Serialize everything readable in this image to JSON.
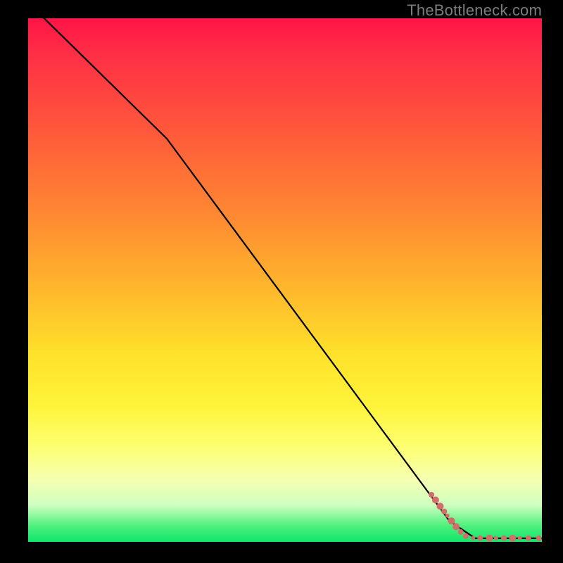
{
  "attribution": "TheBottleneck.com",
  "colors": {
    "gradient_top": "#ff1547",
    "gradient_mid": "#ffe12a",
    "gradient_bottom": "#10e66a",
    "curve": "#000000",
    "points": "#d26d6a",
    "background": "#000000"
  },
  "chart_data": {
    "type": "line",
    "title": "",
    "xlabel": "",
    "ylabel": "",
    "xlim": [
      0,
      100
    ],
    "ylim": [
      0,
      100
    ],
    "grid": false,
    "legend": false,
    "curve": [
      {
        "x": 0,
        "y": 103
      },
      {
        "x": 27,
        "y": 77
      },
      {
        "x": 82,
        "y": 4
      },
      {
        "x": 87,
        "y": 0.7
      },
      {
        "x": 100,
        "y": 0.7
      }
    ],
    "curve_note": "y is percent of plot height from bottom; two-segment descent with slight slope change near x≈27, then flat at bottom after x≈87",
    "points": [
      {
        "x": 78.5,
        "y": 9.0,
        "r": 4
      },
      {
        "x": 79.3,
        "y": 8.0,
        "r": 5
      },
      {
        "x": 80.2,
        "y": 6.8,
        "r": 5
      },
      {
        "x": 81.0,
        "y": 5.8,
        "r": 4
      },
      {
        "x": 81.6,
        "y": 5.0,
        "r": 3
      },
      {
        "x": 82.4,
        "y": 4.0,
        "r": 5
      },
      {
        "x": 83.3,
        "y": 2.9,
        "r": 5
      },
      {
        "x": 84.2,
        "y": 1.9,
        "r": 4
      },
      {
        "x": 85.2,
        "y": 1.1,
        "r": 4
      },
      {
        "x": 86.6,
        "y": 0.7,
        "r": 3
      },
      {
        "x": 88.0,
        "y": 0.7,
        "r": 4
      },
      {
        "x": 89.8,
        "y": 0.7,
        "r": 5
      },
      {
        "x": 91.1,
        "y": 0.7,
        "r": 3
      },
      {
        "x": 92.6,
        "y": 0.7,
        "r": 4
      },
      {
        "x": 94.3,
        "y": 0.7,
        "r": 5
      },
      {
        "x": 95.7,
        "y": 0.7,
        "r": 3
      },
      {
        "x": 97.4,
        "y": 0.7,
        "r": 4
      },
      {
        "x": 99.4,
        "y": 0.7,
        "r": 4
      }
    ],
    "points_note": "clustered scatter points along the lower-right tail of the curve; r is approximate radius in px at 800×800"
  }
}
